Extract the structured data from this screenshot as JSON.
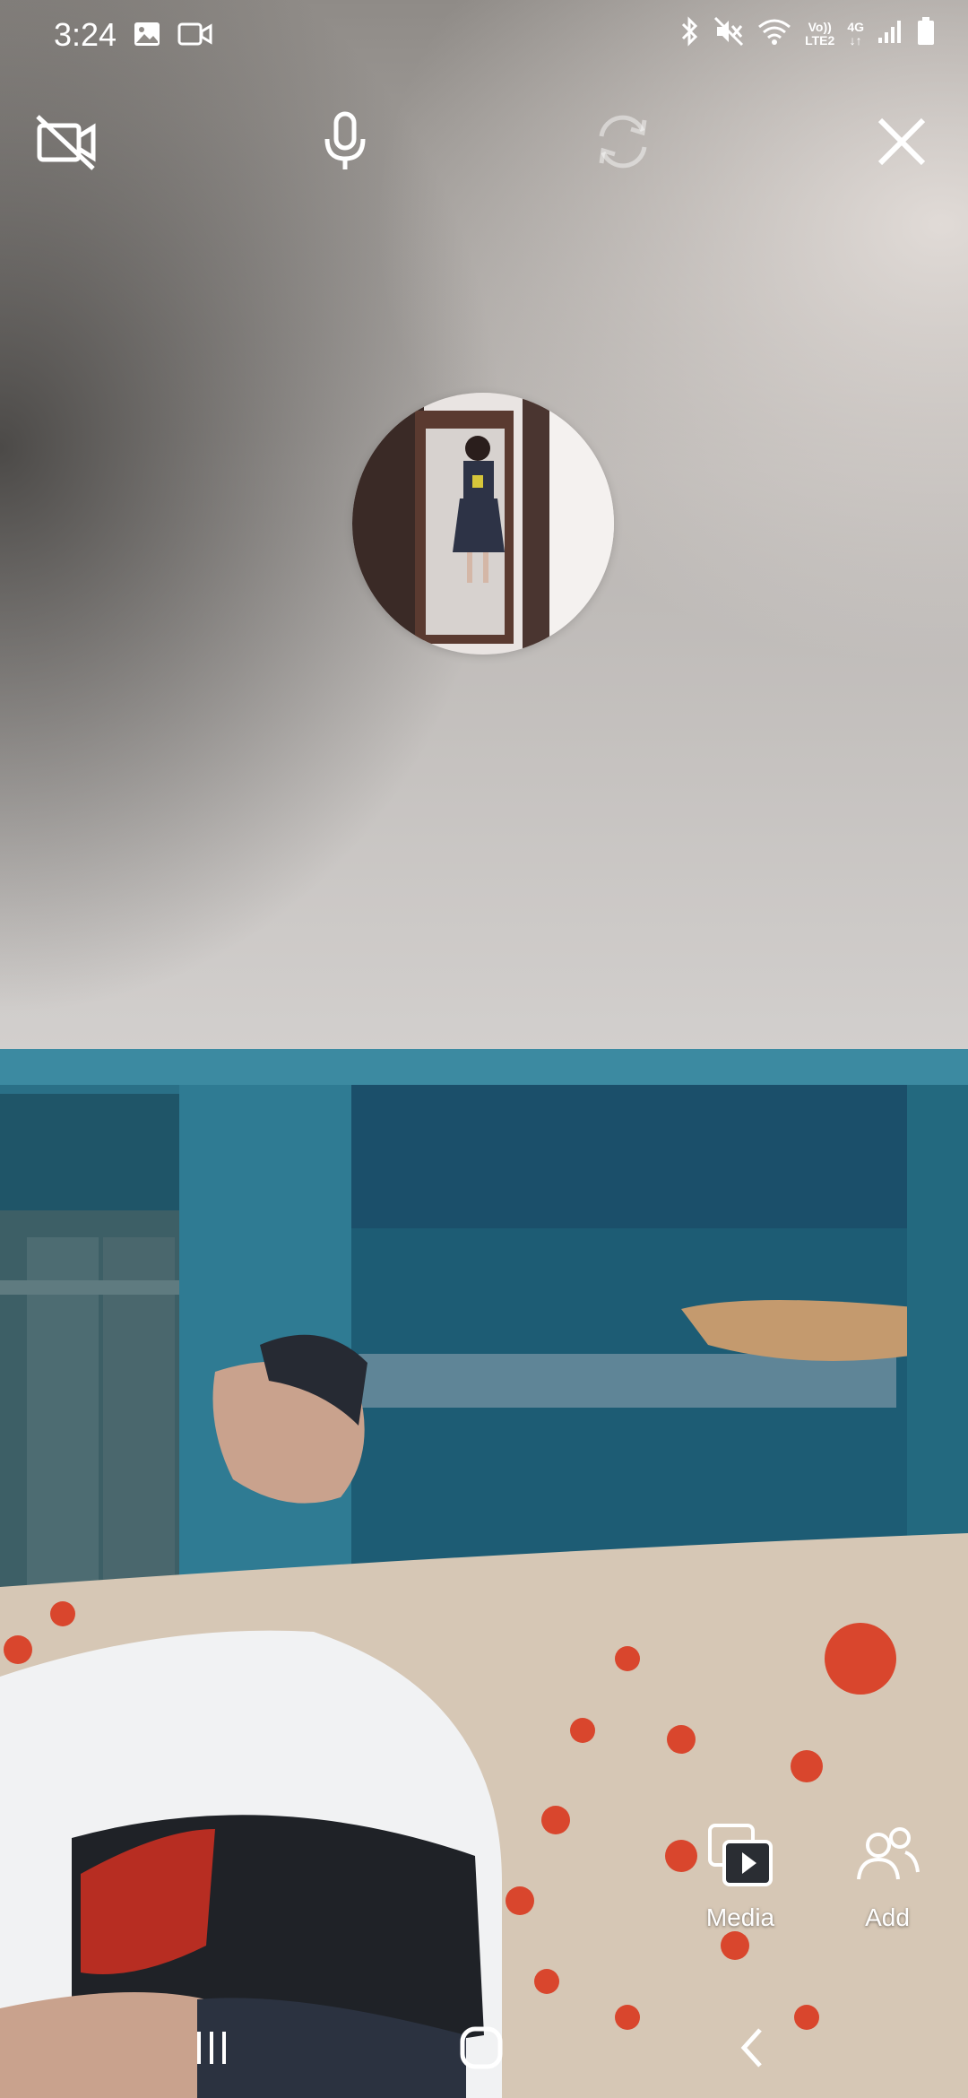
{
  "status_bar": {
    "time": "3:24",
    "left_icons": [
      "gallery-icon",
      "video-call-icon"
    ],
    "right_icons": [
      "bluetooth-icon",
      "mute-icon",
      "wifi-icon",
      "volte-badge",
      "4g-badge",
      "signal-icon",
      "battery-icon"
    ],
    "volte_line1": "Vo))",
    "volte_line2": "LTE2",
    "net_type": "4G"
  },
  "call_controls": {
    "camera_toggle": "video-off-icon",
    "microphone": "microphone-icon",
    "switch_camera": "switch-camera-icon",
    "end_call": "close-icon"
  },
  "remote_participant": {
    "avatar": "profile-photo"
  },
  "actions": {
    "media_label": "Media",
    "add_label": "Add"
  },
  "nav_bar": {
    "items": [
      "recent-apps-icon",
      "home-icon",
      "back-icon"
    ]
  },
  "colors": {
    "top_gradient_light": "#d9d4d1",
    "top_gradient_dark": "#4a4745",
    "wall": "#2a7087",
    "sofa": "#d6c7b5",
    "flower": "#d9462d"
  }
}
